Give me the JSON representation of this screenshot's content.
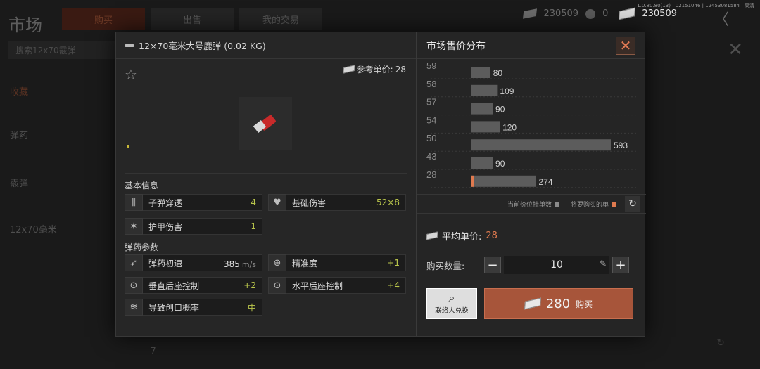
{
  "background": {
    "title": "市场",
    "tabs": [
      {
        "label": "购买",
        "active": true
      },
      {
        "label": "出售",
        "active": false
      },
      {
        "label": "我的交易",
        "active": false
      }
    ],
    "search_text": "搜索12x70霰弹",
    "sidebar": [
      "收藏",
      "弹药",
      "霰弹",
      "12x70毫米"
    ],
    "bottom_count": "7",
    "money_secondary": "230509",
    "coin_value": "0",
    "money_primary": "230509",
    "version": "1.0.80.80(13) | 02151046 | 12453081584 | 高清"
  },
  "item": {
    "title": "12×70毫米大号鹿弹 (0.02 KG)",
    "ref_price_label": "参考单价:",
    "ref_price_value": "28",
    "basic_info_title": "基本信息",
    "ammo_params_title": "弹药参数",
    "stats": {
      "penetration": {
        "label": "子弹穿透",
        "value": "4",
        "icon": "penetration-icon"
      },
      "base_damage": {
        "label": "基础伤害",
        "value": "52×8",
        "icon": "broken-heart-icon"
      },
      "armor_damage": {
        "label": "护甲伤害",
        "value": "1",
        "icon": "armor-damage-icon"
      },
      "muzzle_velocity": {
        "label": "弹药初速",
        "value": "385",
        "unit": "m/s",
        "icon": "velocity-icon"
      },
      "accuracy": {
        "label": "精准度",
        "value": "+1",
        "icon": "crosshair-icon"
      },
      "vertical_recoil": {
        "label": "垂直后座控制",
        "value": "+2",
        "icon": "vertical-recoil-icon"
      },
      "horizontal_recoil": {
        "label": "水平后座控制",
        "value": "+4",
        "icon": "horizontal-recoil-icon"
      },
      "bleed_chance": {
        "label": "导致创口概率",
        "value": "中",
        "icon": "bleed-icon"
      }
    }
  },
  "market": {
    "title": "市场售价分布",
    "legend_current": "当前价位挂单数",
    "legend_mine": "将要购买的单",
    "avg_price_label": "平均单价:",
    "avg_price_value": "28",
    "qty_label": "购买数量:",
    "qty_value": "10",
    "contact_label": "联络人兑换",
    "buy_price": "280",
    "buy_label": "购买",
    "colors": {
      "accent": "#e07a4f",
      "bar": "#5a5a5a",
      "buy_button": "#a7553a"
    }
  },
  "chart_data": {
    "type": "bar",
    "orientation": "horizontal",
    "categories": [
      "59",
      "58",
      "57",
      "54",
      "50",
      "43",
      "28"
    ],
    "values": [
      80,
      109,
      90,
      120,
      593,
      90,
      274
    ],
    "highlighted_category": "28",
    "xlim": [
      0,
      593
    ]
  }
}
